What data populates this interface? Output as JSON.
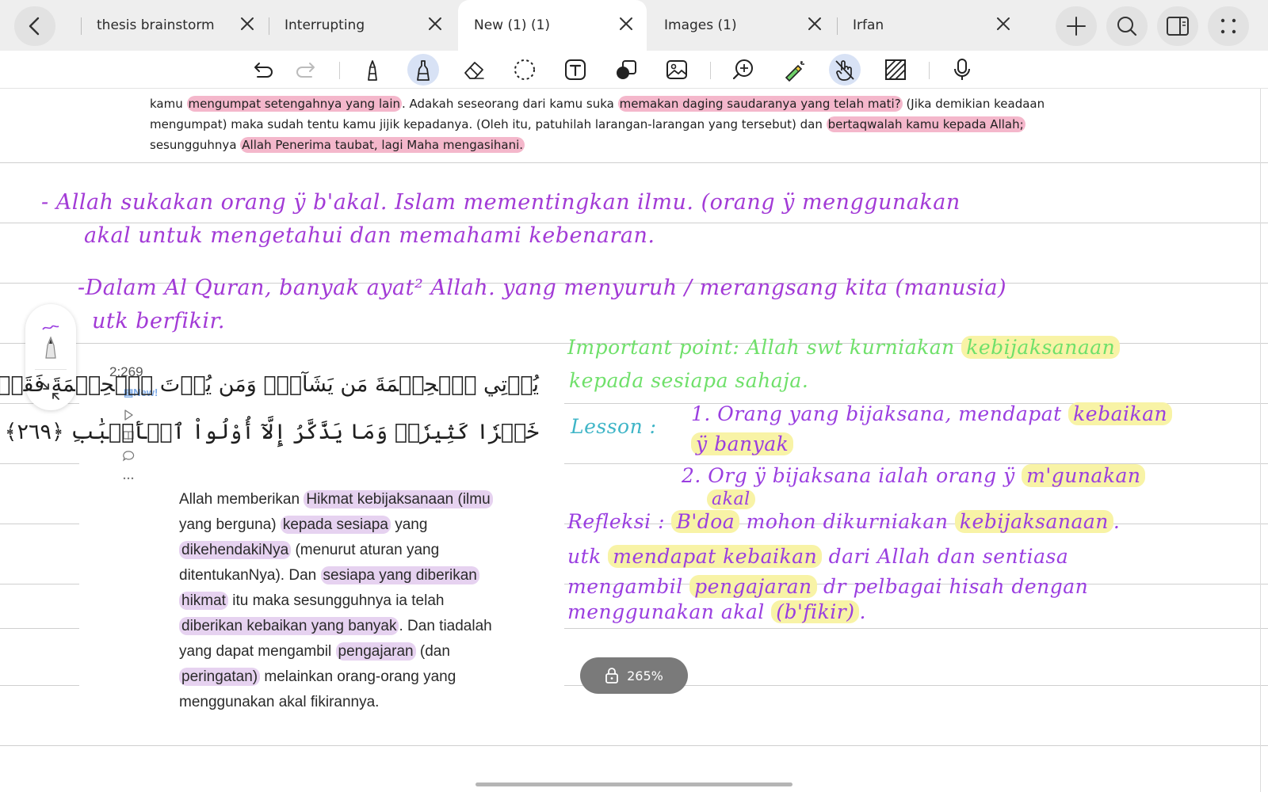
{
  "tabs": [
    {
      "label": "thesis brainstorm",
      "active": false
    },
    {
      "label": "Interrupting",
      "active": false
    },
    {
      "label": "New (1) (1)",
      "active": true
    },
    {
      "label": "Images (1)",
      "active": false
    },
    {
      "label": "Irfan",
      "active": false
    }
  ],
  "toolbar_icons": [
    "undo-icon",
    "redo-icon",
    "pen-icon",
    "highlighter-icon",
    "eraser-icon",
    "lasso-icon",
    "text-box-icon",
    "shapes-icon",
    "image-icon",
    "zoom-icon",
    "laser-pointer-icon",
    "hand-touch-icon",
    "pattern-icon",
    "microphone-icon"
  ],
  "top_text": {
    "line1_a": "kamu ",
    "line1_hl1": "mengumpat setengahnya yang lain",
    "line1_b": ". Adakah seseorang dari kamu suka ",
    "line1_hl2": "memakan daging saudaranya yang telah mati?",
    "line1_c": " (Jika demikian keadaan",
    "line2_a": "mengumpat) maka sudah tentu kamu jijik kepadanya. (Oleh itu, patuhilah larangan-larangan yang tersebut) dan ",
    "line2_hl": "bertaqwalah kamu kepada Allah;",
    "line3_a": "sesungguhnya ",
    "line3_hl": "Allah Penerima taubat, lagi Maha mengasihani."
  },
  "handwriting": {
    "note1_line1": "- Allah sukakan orang ÿ b'akal. Islam mementingkan ilmu. (orang ÿ menggunakan",
    "note1_line2": "akal untuk mengetahui dan memahami kebenaran.",
    "note2_line1": "-Dalam Al Quran, banyak ayat² Allah. yang menyuruh / merangsang kita (manusia)",
    "note2_line2": "utk berfikir.",
    "important_a": "Important point: Allah swt kurniakan ",
    "important_hl": "kebijaksanaan",
    "important_line2": "kepada sesiapa sahaja.",
    "lesson_label": "Lesson :",
    "lesson1_a": "1. Orang yang bijaksana, mendapat ",
    "lesson1_hl": "kebaikan",
    "lesson1_line2_hl": "ÿ banyak",
    "lesson2_a": "2. Org ÿ bijaksana ialah orang ÿ ",
    "lesson2_hl": "m'gunakan",
    "lesson2_line2_hl": "akal",
    "refleksi_a": "Refleksi : ",
    "refleksi_hl1": "B'doa",
    "refleksi_b": " mohon dikurniakan ",
    "refleksi_hl2": "kebijaksanaan",
    "refleksi_c": ".",
    "refleksi_line2_a": "utk ",
    "refleksi_line2_hl": "mendapat kebaikan",
    "refleksi_line2_b": " dari Allah dan sentiasa",
    "refleksi_line3_a": "mengambil ",
    "refleksi_line3_hl": "pengajaran",
    "refleksi_line3_b": " dr pelbagai hisah dengan",
    "refleksi_line4_a": "menggunakan akal ",
    "refleksi_line4_hl": "(b'fikir)",
    "refleksi_line4_b": "."
  },
  "quran": {
    "verse_ref": "2:269",
    "new_badge": "New!",
    "arabic_line1": "يُؤۡتِي ٱلۡحِكۡمَةَ مَن يَشَآءُۚ وَمَن يُؤۡتَ ٱلۡحِكۡمَةَ فَقَدۡ أُوتِيَ",
    "arabic_line2": "خَيۡرٗا كَثِيرٗاۗ وَمَا يَذَّكَّرُ إِلَّآ أُوْلُواْ ٱلۡأَلۡبَٰبِ ﴿٢٦٩﴾",
    "translation": {
      "l1_a": "Allah memberikan ",
      "l1_hl": "Hikmat kebijaksanaan (ilmu",
      "l2_a": "yang berguna) ",
      "l2_hl": "kepada sesiapa",
      "l2_b": " yang",
      "l3_hl": "dikehendakiNya",
      "l3_b": " (menurut aturan yang",
      "l4_a": "ditentukanNya). Dan ",
      "l4_hl": "sesiapa yang diberikan",
      "l5_hl": "hikmat",
      "l5_b": " itu maka sesungguhnya ia telah",
      "l6_hl": "diberikan kebaikan yang banyak",
      "l6_b": ". Dan tiadalah",
      "l7_a": "yang dapat mengambil ",
      "l7_hl": "pengajaran",
      "l7_b": " (dan",
      "l8_hl": "peringatan)",
      "l8_b": " melainkan orang-orang yang",
      "l9_a": "menggunakan akal fikirannya."
    }
  },
  "zoom": {
    "label": "265%"
  },
  "colors": {
    "ink_purple": "#a23ad6",
    "ink_green": "#6fe06a",
    "ink_teal": "#3fb5c7",
    "highlight_pink": "#f4b7cb",
    "highlight_yellow": "#f8f3a6",
    "highlight_purple": "#e6d2f0"
  }
}
